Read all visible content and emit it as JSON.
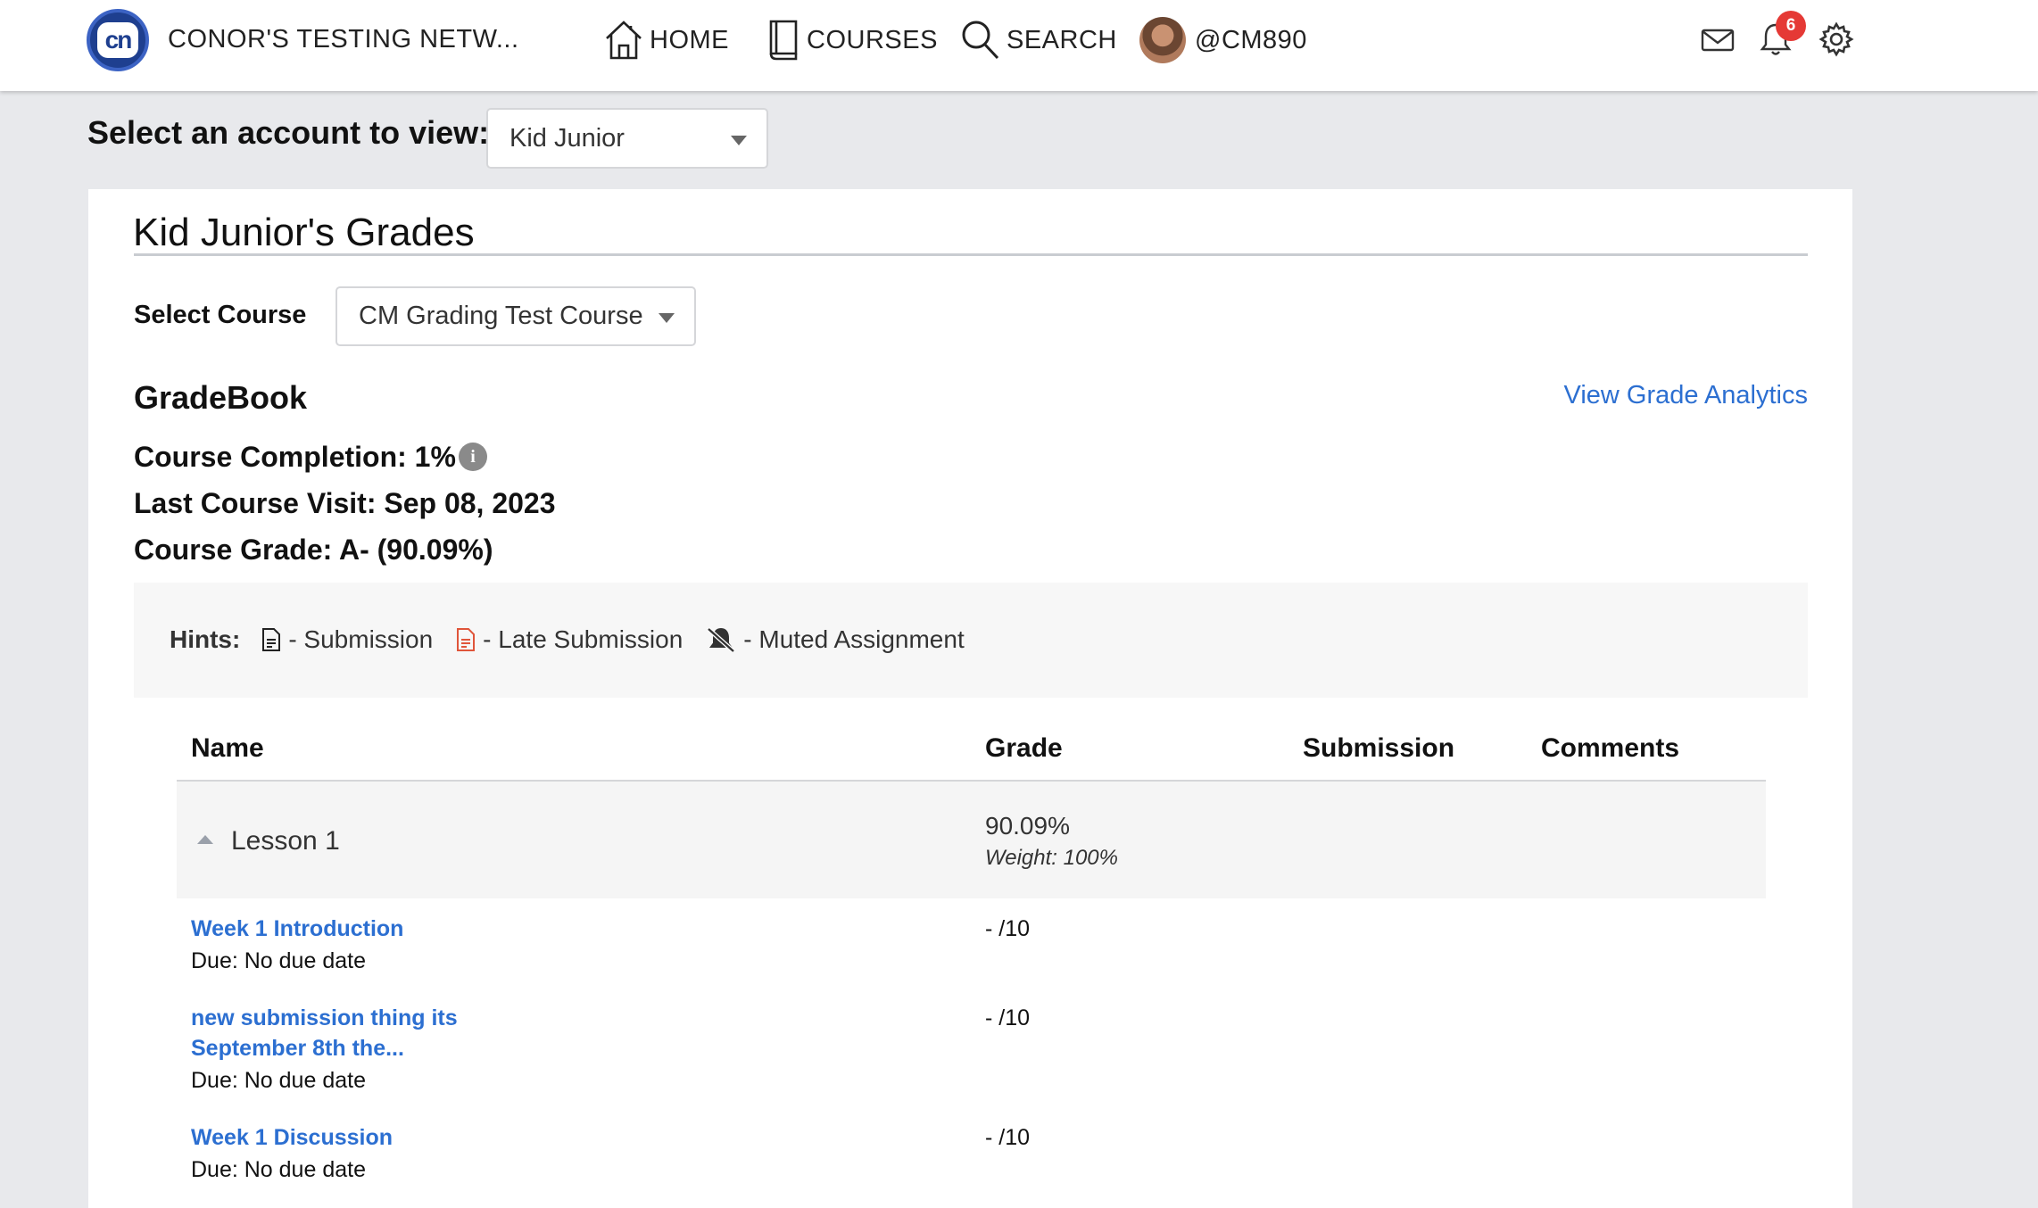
{
  "topbar": {
    "network_name": "CONOR'S TESTING NETW...",
    "logo_text": "cn",
    "nav": {
      "home": "HOME",
      "courses": "COURSES",
      "search": "SEARCH",
      "profile": "@CM890"
    },
    "notification_count": "6"
  },
  "account": {
    "label": "Select an account to view:",
    "selected": "Kid Junior"
  },
  "card": {
    "title": "Kid Junior's Grades",
    "course_label": "Select Course",
    "course_selected": "CM Grading Test Course",
    "gradebook_title": "GradeBook",
    "analytics_link": "View Grade Analytics",
    "completion": "Course Completion: 1%",
    "last_visit": "Last Course Visit: Sep 08, 2023",
    "course_grade": "Course Grade: A- (90.09%)"
  },
  "hints": {
    "label": "Hints:",
    "submission": "- Submission",
    "late_submission": "- Late Submission",
    "muted": "- Muted Assignment"
  },
  "table": {
    "headers": {
      "name": "Name",
      "grade": "Grade",
      "submission": "Submission",
      "comments": "Comments"
    },
    "group": {
      "name": "Lesson 1",
      "grade": "90.09%",
      "weight": "Weight: 100%"
    },
    "items": [
      {
        "name": "Week 1 Introduction",
        "due": "Due: No due date",
        "grade": "- /10"
      },
      {
        "name_line1": "new submission thing its",
        "name_line2": "September 8th the...",
        "due": "Due: No due date",
        "grade": "- /10"
      },
      {
        "name": "Week 1 Discussion",
        "due": "Due: No due date",
        "grade": "- /10"
      }
    ]
  },
  "colors": {
    "link": "#2c6fd1",
    "badge": "#e53935",
    "logo": "#1e3f8f",
    "late_icon": "#e0553a"
  }
}
